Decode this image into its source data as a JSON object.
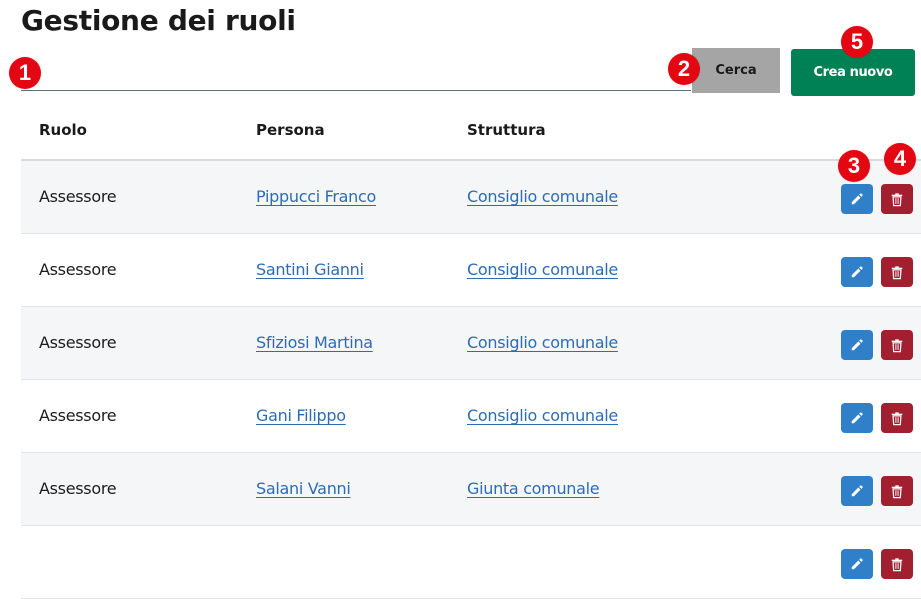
{
  "page": {
    "title": "Gestione dei ruoli"
  },
  "search": {
    "value": "",
    "placeholder": "",
    "button_label": "Cerca"
  },
  "actions": {
    "create_label": "Crea nuovo"
  },
  "table": {
    "headers": {
      "role": "Ruolo",
      "person": "Persona",
      "structure": "Struttura"
    },
    "rows": [
      {
        "role": "Assessore",
        "person": "Pippucci Franco",
        "structure": "Consiglio comunale"
      },
      {
        "role": "Assessore",
        "person": "Santini Gianni",
        "structure": "Consiglio comunale"
      },
      {
        "role": "Assessore",
        "person": "Sfiziosi Martina",
        "structure": "Consiglio comunale"
      },
      {
        "role": "Assessore",
        "person": "Gani Filippo",
        "structure": "Consiglio comunale"
      },
      {
        "role": "Assessore",
        "person": "Salani Vanni",
        "structure": "Giunta comunale"
      },
      {
        "role": "",
        "person": "",
        "structure": ""
      }
    ]
  },
  "annotations": [
    "1",
    "2",
    "3",
    "4",
    "5"
  ],
  "icons": {
    "edit": "pencil-icon",
    "delete": "trash-icon"
  },
  "colors": {
    "primary": "#2f80c9",
    "danger": "#a21f30",
    "success": "#008055",
    "link": "#2d6cb4",
    "badge": "#e30613"
  }
}
